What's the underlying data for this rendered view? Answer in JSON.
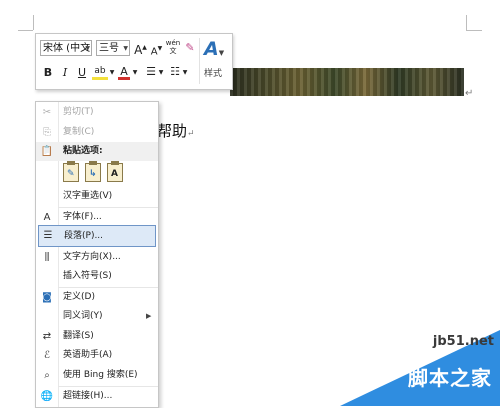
{
  "document": {
    "text_fragment": "帮助",
    "paragraph_mark": "↵"
  },
  "mini_toolbar": {
    "font_name": "宋体 (中文",
    "font_size": "三号",
    "grow_font": "A",
    "shrink_font": "A",
    "phonetic": "wén 文",
    "clear_format": "✎",
    "bold": "B",
    "italic": "I",
    "underline": "U",
    "highlight": "ab",
    "font_color": "A",
    "bullets": "☰",
    "numbering": "☷",
    "styles_icon": "A",
    "styles_label": "样式"
  },
  "context_menu": {
    "cut": "剪切(T)",
    "copy": "复制(C)",
    "paste_options_header": "粘贴选项:",
    "hanzi_reselect": "汉字重选(V)",
    "font": "字体(F)...",
    "paragraph": "段落(P)...",
    "text_direction": "文字方向(X)...",
    "insert_symbol": "插入符号(S)",
    "define": "定义(D)",
    "synonyms": "同义词(Y)",
    "translate": "翻译(S)",
    "english_assistant": "英语助手(A)",
    "bing_search": "使用 Bing 搜索(E)",
    "hyperlink": "超链接(H)...",
    "submenu_arrow": "▶"
  },
  "watermark": {
    "url": "jb51.net",
    "name": "脚本之家"
  },
  "colors": {
    "highlight_bg": "#dde9f7",
    "highlight_border": "#6f95c7",
    "accent_blue": "#2b6fb6",
    "font_color_red": "#d0312d"
  }
}
